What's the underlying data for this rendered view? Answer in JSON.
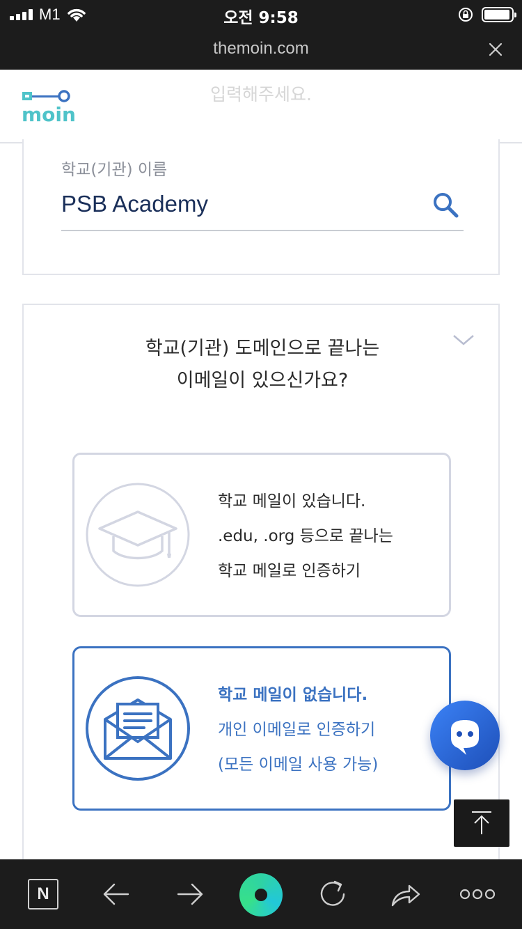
{
  "status_bar": {
    "carrier": "M1",
    "time": "오전 9:58"
  },
  "browser": {
    "url": "themoin.com"
  },
  "header": {
    "ghost_text": "입력해주세요.",
    "logo_text": "moin"
  },
  "school_field": {
    "label": "학교(기관) 이름",
    "value": "PSB Academy"
  },
  "email_question": {
    "line1": "학교(기관) 도메인으로 끝나는",
    "line2": "이메일이 있으신가요?"
  },
  "options": [
    {
      "line1": "학교 메일이 있습니다.",
      "line2": ".edu, .org 등으로 끝나는",
      "line3": "학교 메일로 인증하기",
      "icon": "graduation-cap-icon"
    },
    {
      "line1": "학교 메일이 없습니다.",
      "line2": "개인 이메일로 인증하기",
      "line3": "(모든 이메일 사용 가능)",
      "icon": "envelope-icon"
    }
  ],
  "toolbar": {
    "n_label": "N"
  },
  "colors": {
    "accent": "#3b72c1",
    "brand_teal": "#4fc3c9",
    "dark_bar": "#1c1c1c"
  }
}
